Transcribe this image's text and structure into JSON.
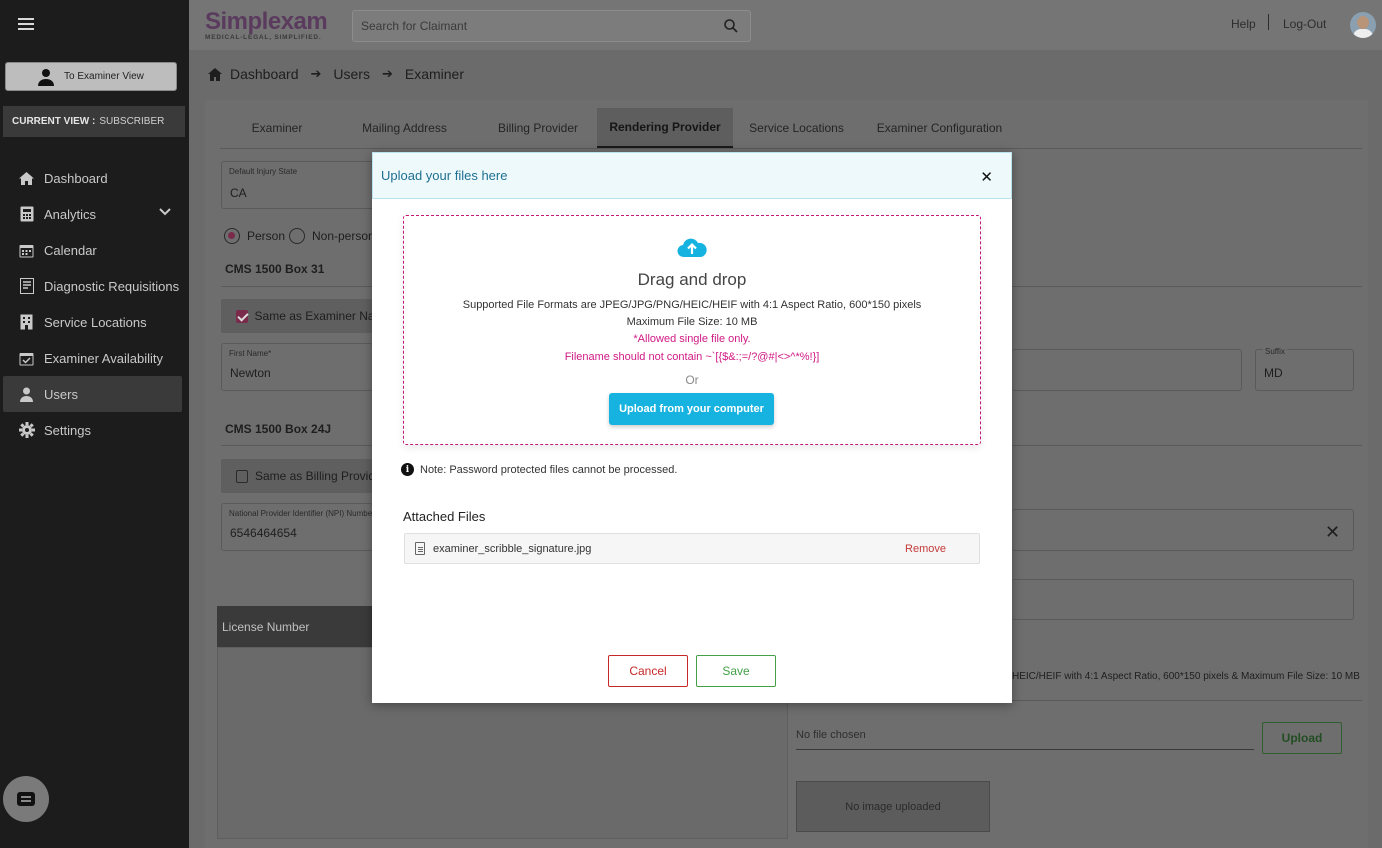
{
  "header": {
    "logo_word": "Simplexam",
    "logo_tagline": "MEDICAL-LEGAL, SIMPLIFIED.",
    "search_placeholder": "Search for Claimant",
    "help": "Help",
    "logout": "Log-Out"
  },
  "sidebar": {
    "examiner_view_button": "To Examiner View",
    "current_view_label": "CURRENT VIEW :",
    "current_view_value": "SUBSCRIBER",
    "items": [
      {
        "label": "Dashboard",
        "icon": "home-icon"
      },
      {
        "label": "Analytics",
        "icon": "calculator-icon"
      },
      {
        "label": "Calendar",
        "icon": "calendar-icon"
      },
      {
        "label": "Diagnostic Requisitions",
        "icon": "clipboard-icon"
      },
      {
        "label": "Service Locations",
        "icon": "building-icon"
      },
      {
        "label": "Examiner Availability",
        "icon": "calendar-check-icon"
      },
      {
        "label": "Users",
        "icon": "user-icon"
      },
      {
        "label": "Settings",
        "icon": "gear-icon"
      }
    ],
    "active_item": "Users"
  },
  "breadcrumb": [
    "Dashboard",
    "Users",
    "Examiner"
  ],
  "tabs": [
    "Examiner",
    "Mailing Address",
    "Billing Provider",
    "Rendering Provider",
    "Service Locations",
    "Examiner Configuration"
  ],
  "active_tab": "Rendering Provider",
  "form": {
    "injury_state_label": "Default Injury State",
    "injury_state_value": "CA",
    "radio_person": "Person",
    "radio_nonperson": "Non-person",
    "box31_title": "CMS 1500 Box 31",
    "same_as_examiner": "Same as Examiner Name",
    "first_name_label": "First Name*",
    "first_name_value": "Newton",
    "suffix_label": "Suffix",
    "suffix_value": "MD",
    "box24j_title": "CMS 1500 Box 24J",
    "same_as_billing": "Same as Billing Provider",
    "npi_label": "National Provider Identifier (NPI) Number",
    "npi_value": "6546464654",
    "license_header": "License Number",
    "formats_hint": "HEIC/HEIF with 4:1 Aspect Ratio, 600*150 pixels & Maximum File Size: 10 MB",
    "no_file": "No file chosen",
    "upload_label": "Upload",
    "no_image": "No image uploaded"
  },
  "modal": {
    "title": "Upload your files here",
    "drag_drop": "Drag and drop",
    "formats": "Supported File Formats are JPEG/JPG/PNG/HEIC/HEIF with 4:1 Aspect Ratio, 600*150 pixels",
    "max_size": "Maximum File Size: 10 MB",
    "single_file": "*Allowed single file only.",
    "filename_rule": "Filename should not contain ~`[{$&:;=/?@#|<>^*%!}]",
    "or": "Or",
    "upload_button": "Upload from your computer",
    "note": "Note: Password protected files cannot be processed.",
    "attached_title": "Attached Files",
    "file_name": "examiner_scribble_signature.jpg",
    "remove": "Remove",
    "cancel": "Cancel",
    "save": "Save"
  },
  "colors": {
    "accent_blue": "#17b3e0",
    "pink": "#d01a84",
    "cancel_red": "#c62828",
    "save_green": "#43a047"
  }
}
